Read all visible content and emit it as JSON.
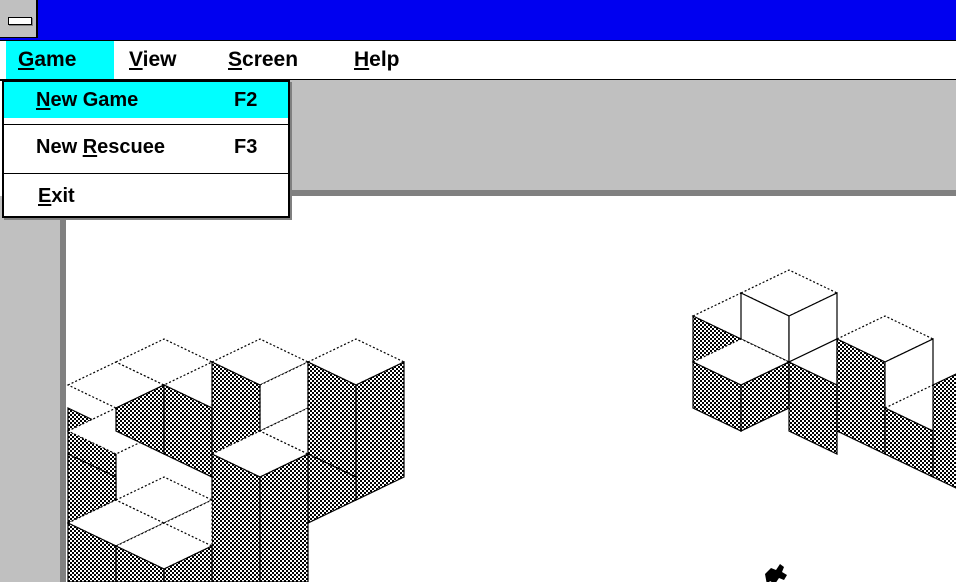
{
  "menubar": {
    "items": [
      {
        "label": "Game",
        "active": true
      },
      {
        "label": "View",
        "active": false
      },
      {
        "label": "Screen",
        "active": false
      },
      {
        "label": "Help",
        "active": false
      }
    ]
  },
  "dropdown": {
    "items": [
      {
        "label": "New Game",
        "shortcut": "F2",
        "highlighted": true
      },
      {
        "label": "New Rescuee",
        "shortcut": "F3",
        "highlighted": false
      },
      {
        "label": "Exit",
        "shortcut": "",
        "highlighted": false
      }
    ]
  },
  "icons": {
    "system_menu": "system-menu-icon",
    "rescuee": "rescuee-figure-icon"
  },
  "colors": {
    "title_bar": "#0000f0",
    "menu_highlight": "#00ffff",
    "panel_gray": "#c0c0c0",
    "shadow_gray": "#808080"
  }
}
